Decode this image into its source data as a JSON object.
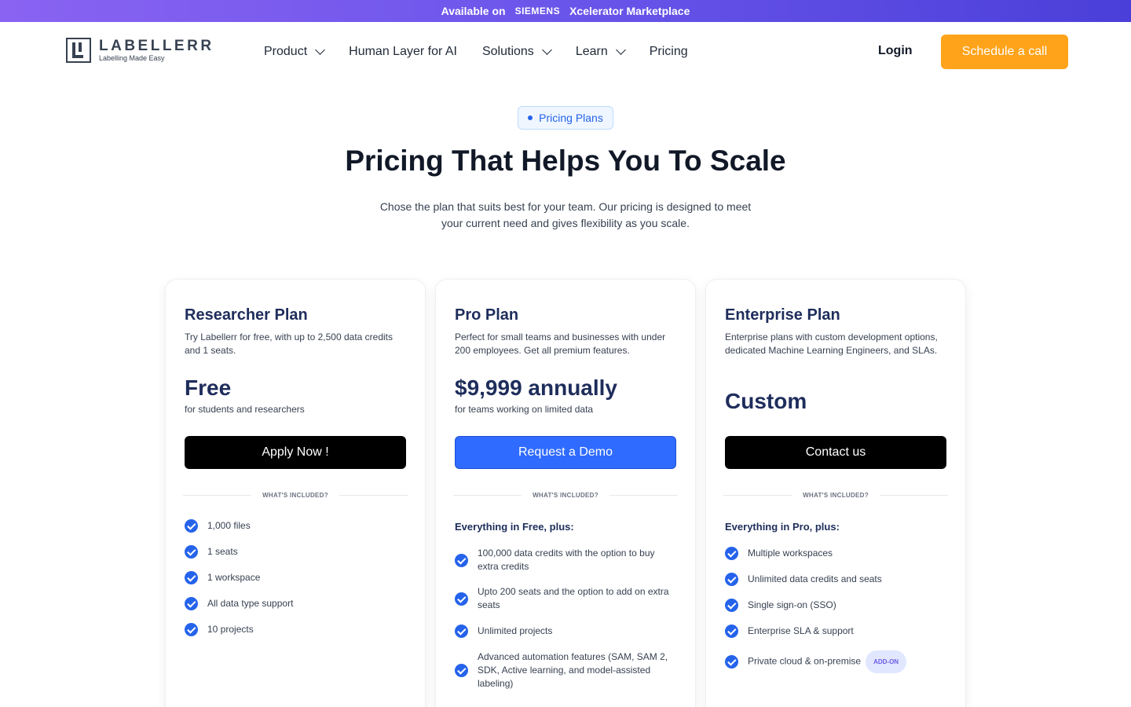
{
  "banner": {
    "prefix": "Available on",
    "brand": "SIEMENS",
    "suffix": "Xcelerator Marketplace"
  },
  "logo": {
    "name": "LABELLERR",
    "tagline": "Labelling Made Easy"
  },
  "nav": {
    "items": [
      {
        "label": "Product",
        "dropdown": true
      },
      {
        "label": "Human Layer for AI",
        "dropdown": false
      },
      {
        "label": "Solutions",
        "dropdown": true
      },
      {
        "label": "Learn",
        "dropdown": true
      },
      {
        "label": "Pricing",
        "dropdown": false
      }
    ],
    "login": "Login",
    "cta": "Schedule a call"
  },
  "hero": {
    "badge": "Pricing Plans",
    "title": "Pricing That Helps You To Scale",
    "subtitle": "Chose the plan that suits best for your team. Our pricing is designed to meet your current need and gives flexibility as you scale."
  },
  "plans": [
    {
      "name": "Researcher Plan",
      "description": "Try Labellerr for free, with up to 2,500 data credits and 1 seats.",
      "price": "Free",
      "price_note": "for students and researchers",
      "button": "Apply Now !",
      "included_label": "WHAT'S INCLUDED?",
      "everything": "",
      "features": [
        "1,000 files",
        "1 seats",
        "1 workspace",
        "All data type support",
        "10 projects"
      ]
    },
    {
      "name": "Pro Plan",
      "description": "Perfect for small teams and businesses with under 200 employees. Get all premium features.",
      "price": "$9,999 annually",
      "price_note": "for teams working on limited data",
      "button": "Request a Demo",
      "included_label": "WHAT'S INCLUDED?",
      "everything": "Everything in Free, plus:",
      "features": [
        "100,000 data credits with the option to buy extra credits",
        "Upto 200 seats and the option to add on extra seats",
        "Unlimited projects",
        "Advanced automation features (SAM, SAM 2, SDK, Active learning, and model-assisted labeling)"
      ]
    },
    {
      "name": "Enterprise Plan",
      "description": "Enterprise plans with custom development options, dedicated Machine Learning Engineers, and SLAs.",
      "price": "Custom",
      "price_note": "",
      "button": "Contact us",
      "included_label": "WHAT'S INCLUDED?",
      "everything": "Everything in Pro, plus:",
      "features": [
        "Multiple workspaces",
        "Unlimited data credits and seats",
        "Single sign-on (SSO)",
        "Enterprise SLA & support",
        "Private cloud & on-premise"
      ],
      "addon_badge": "ADD-ON"
    }
  ],
  "colors": {
    "accent_orange": "#ffa31a",
    "accent_blue": "#2f6bff",
    "heading_navy": "#1e2d5b",
    "check_blue": "#2563eb"
  }
}
